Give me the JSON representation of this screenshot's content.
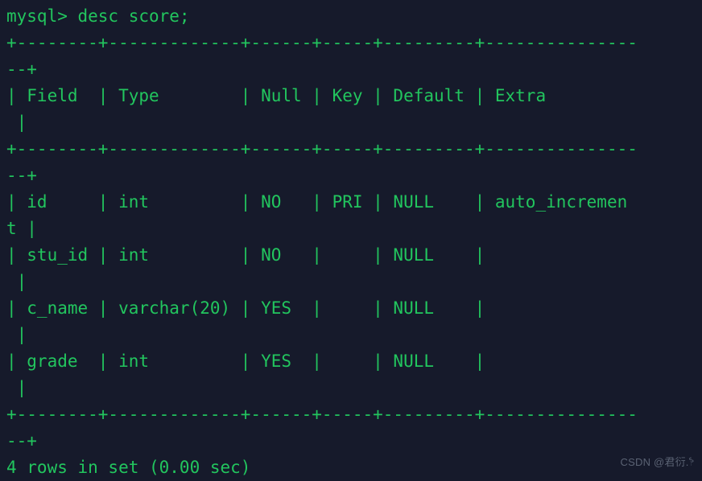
{
  "terminal": {
    "background_color": "#161a2b",
    "text_color": "#22c55e",
    "columns": 62,
    "prompt": "mysql> ",
    "command": "desc score;",
    "prompt_line": "mysql> desc score;",
    "lines": [
      "mysql> desc score;",
      "+--------+-------------+------+-----+---------+---------------",
      "--+",
      "| Field  | Type        | Null | Key | Default | Extra         ",
      " |",
      "+--------+-------------+------+-----+---------+---------------",
      "--+",
      "| id     | int         | NO   | PRI | NULL    | auto_incremen",
      "t |",
      "| stu_id | int         | NO   |     | NULL    |              ",
      " |",
      "| c_name | varchar(20) | YES  |     | NULL    |              ",
      " |",
      "| grade  | int         | YES  |     | NULL    |              ",
      " |",
      "+--------+-------------+------+-----+---------+---------------",
      "--+",
      "4 rows in set (0.00 sec)"
    ],
    "result_status": "4 rows in set (0.00 sec)",
    "row_count": "4",
    "elapsed": "0.00 sec"
  },
  "table": {
    "name": "score",
    "columns": [
      "Field",
      "Type",
      "Null",
      "Key",
      "Default",
      "Extra"
    ],
    "rows": [
      {
        "Field": "id",
        "Type": "int",
        "Null": "NO",
        "Key": "PRI",
        "Default": "NULL",
        "Extra": "auto_increment"
      },
      {
        "Field": "stu_id",
        "Type": "int",
        "Null": "NO",
        "Key": "",
        "Default": "NULL",
        "Extra": ""
      },
      {
        "Field": "c_name",
        "Type": "varchar(20)",
        "Null": "YES",
        "Key": "",
        "Default": "NULL",
        "Extra": ""
      },
      {
        "Field": "grade",
        "Type": "int",
        "Null": "YES",
        "Key": "",
        "Default": "NULL",
        "Extra": ""
      }
    ]
  },
  "watermark": {
    "text": "CSDN @君衍.෦",
    "color": "#5a6273"
  }
}
